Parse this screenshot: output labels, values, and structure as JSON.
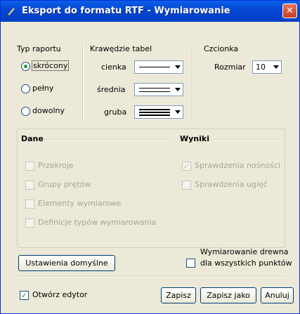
{
  "window": {
    "title": "Eksport do formatu RTF - Wymiarowanie",
    "close_glyph": "✕"
  },
  "report_type": {
    "heading": "Typ raportu",
    "options": [
      {
        "label": "skrócony",
        "selected": true
      },
      {
        "label": "pełny",
        "selected": false
      },
      {
        "label": "dowolny",
        "selected": false
      }
    ]
  },
  "table_borders": {
    "heading": "Krawędzie tabel",
    "rows": [
      {
        "label": "cienka",
        "line_style": "single"
      },
      {
        "label": "średnia",
        "line_style": "double"
      },
      {
        "label": "gruba",
        "line_style": "triple"
      }
    ]
  },
  "font": {
    "heading": "Czcionka",
    "size_label": "Rozmiar",
    "size_value": "10"
  },
  "data_section": {
    "heading": "Dane",
    "items": [
      {
        "label": "Przekroje",
        "checked": false,
        "enabled": false
      },
      {
        "label": "Grupy prętów",
        "checked": false,
        "enabled": false
      },
      {
        "label": "Elementy wymiarowe",
        "checked": false,
        "enabled": false
      },
      {
        "label": "Definicje typów wymiarowania",
        "checked": false,
        "enabled": false
      }
    ]
  },
  "results_section": {
    "heading": "Wyniki",
    "items": [
      {
        "label": "Sprawdzenia nośności",
        "checked": true,
        "enabled": false
      },
      {
        "label": "Sprawdzenia ugięć",
        "checked": false,
        "enabled": false
      }
    ]
  },
  "defaults_button": "Ustawienia domyślne",
  "timber_option": {
    "line1": "Wymiarowanie drewna",
    "line2": "dla wszystkich punktów",
    "checked": false
  },
  "open_editor": {
    "label": "Otwórz edytor",
    "checked": true
  },
  "buttons": {
    "save": "Zapisz",
    "save_as": "Zapisz jako",
    "cancel": "Anuluj"
  },
  "colors": {
    "title_bar": "#0545d2",
    "dialog_bg": "#ece9d8",
    "disabled_text": "#a8a594",
    "check_mark": "#21a121"
  }
}
